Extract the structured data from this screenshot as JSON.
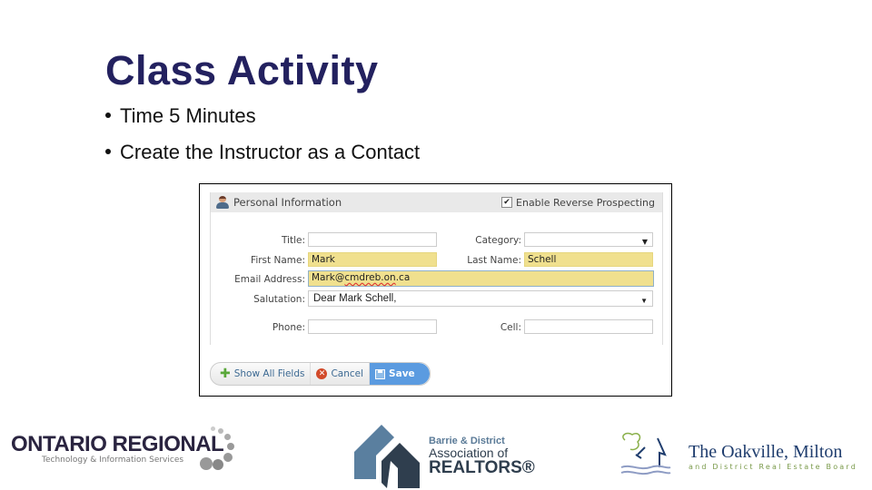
{
  "slide": {
    "title": "Class Activity",
    "bullets": [
      "Time 5 Minutes",
      "Create the Instructor as a Contact"
    ]
  },
  "form": {
    "section_title": "Personal Information",
    "section_icon": "person-icon",
    "reverse_prospecting": {
      "label": "Enable Reverse Prospecting",
      "checked": true
    },
    "fields": {
      "title": {
        "label": "Title:",
        "value": ""
      },
      "category": {
        "label": "Category:",
        "value": ""
      },
      "first_name": {
        "label": "First Name:",
        "value": "Mark"
      },
      "last_name": {
        "label": "Last Name:",
        "value": "Schell"
      },
      "email": {
        "label": "Email Address:",
        "value_user": "Mark@",
        "value_domain": "cmdreb.on",
        "value_tld": ".ca"
      },
      "salutation": {
        "label": "Salutation:",
        "value": "Dear Mark Schell,"
      },
      "phone": {
        "label": "Phone:",
        "value": ""
      },
      "cell": {
        "label": "Cell:",
        "value": ""
      }
    },
    "buttons": {
      "show_all": "Show All Fields",
      "cancel": "Cancel",
      "save": "Save"
    },
    "colors": {
      "highlight": "#f0e08e",
      "save_button": "#5b9be0",
      "link": "#3d6a93"
    }
  },
  "logos": {
    "ontario": {
      "name": "ONTARIO REGIONAL",
      "tagline": "Technology & Information Services"
    },
    "barrie": {
      "line1": "Barrie & District",
      "line2": "Association of",
      "line3": "REALTORS®"
    },
    "oakville": {
      "name": "The Oakville, Milton",
      "tagline": "and District Real Estate Board"
    }
  }
}
